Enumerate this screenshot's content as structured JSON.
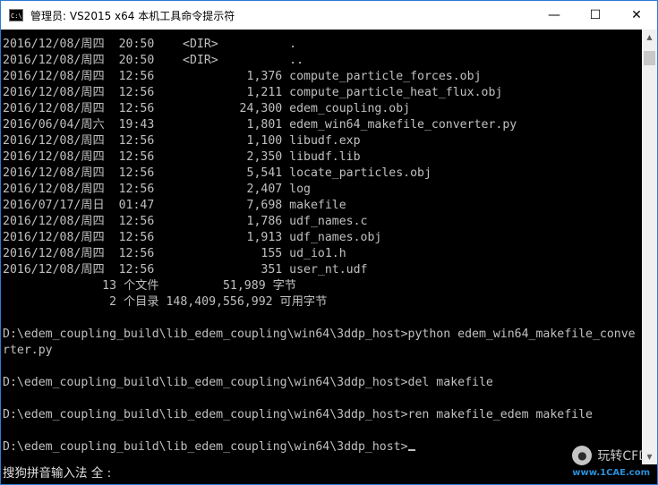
{
  "window": {
    "title": "管理员: VS2015 x64 本机工具命令提示符",
    "icon": "console-app-icon",
    "icon_text": "C:\\",
    "controls": {
      "minimize": "—",
      "maximize": "☐",
      "close": "✕"
    }
  },
  "console": {
    "lines": [
      "2016/12/08/周四  20:50    <DIR>          .",
      "2016/12/08/周四  20:50    <DIR>          ..",
      "2016/12/08/周四  12:56             1,376 compute_particle_forces.obj",
      "2016/12/08/周四  12:56             1,211 compute_particle_heat_flux.obj",
      "2016/12/08/周四  12:56            24,300 edem_coupling.obj",
      "2016/06/04/周六  19:43             1,801 edem_win64_makefile_converter.py",
      "2016/12/08/周四  12:56             1,100 libudf.exp",
      "2016/12/08/周四  12:56             2,350 libudf.lib",
      "2016/12/08/周四  12:56             5,541 locate_particles.obj",
      "2016/12/08/周四  12:56             2,407 log",
      "2016/07/17/周日  01:47             7,698 makefile",
      "2016/12/08/周四  12:56             1,786 udf_names.c",
      "2016/12/08/周四  12:56             1,913 udf_names.obj",
      "2016/12/08/周四  12:56               155 ud_io1.h",
      "2016/12/08/周四  12:56               351 user_nt.udf",
      "              13 个文件         51,989 字节",
      "               2 个目录 148,409,556,992 可用字节",
      "",
      "D:\\edem_coupling_build\\lib_edem_coupling\\win64\\3ddp_host>python edem_win64_makefile_conve",
      "rter.py",
      "",
      "D:\\edem_coupling_build\\lib_edem_coupling\\win64\\3ddp_host>del makefile",
      "",
      "D:\\edem_coupling_build\\lib_edem_coupling\\win64\\3ddp_host>ren makefile_edem makefile",
      "",
      "D:\\edem_coupling_build\\lib_edem_coupling\\win64\\3ddp_host>"
    ]
  },
  "ime": {
    "status": "搜狗拼音输入法 全 :"
  },
  "watermark": {
    "logo_icon": "wechat-icon",
    "text": "玩转CFD",
    "site": "www.1CAE.com"
  },
  "colors": {
    "console_bg": "#000000",
    "console_fg": "#c0c0c0",
    "titlebar_bg": "#ffffff",
    "border": "#2b7bd3"
  }
}
